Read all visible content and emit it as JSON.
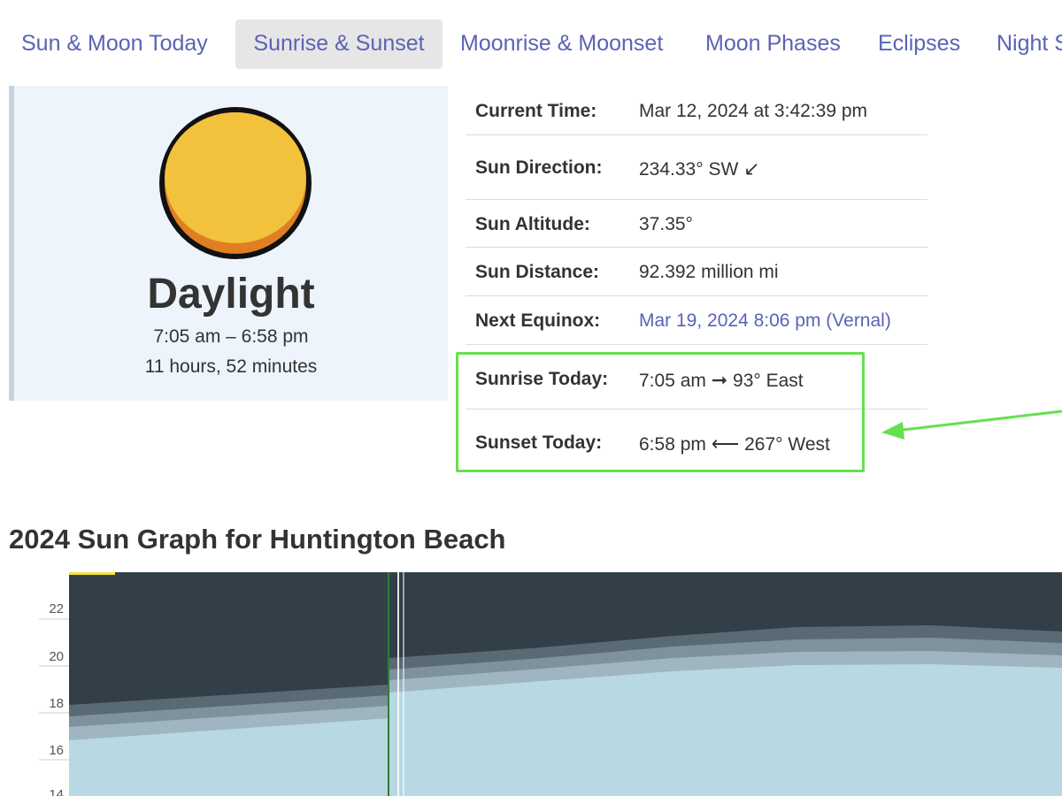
{
  "nav": {
    "tabs": [
      {
        "label": "Sun & Moon Today",
        "active": false
      },
      {
        "label": "Sunrise & Sunset",
        "active": true
      },
      {
        "label": "Moonrise & Moonset",
        "active": false
      },
      {
        "label": "Moon Phases",
        "active": false
      },
      {
        "label": "Eclipses",
        "active": false
      },
      {
        "label": "Night S",
        "active": false
      }
    ]
  },
  "sun_panel": {
    "icon": "sun-icon",
    "title": "Daylight",
    "range": "7:05 am – 6:58 pm",
    "length": "11 hours, 52 minutes",
    "colors": {
      "sun_fill": "#f2c23c",
      "sun_shade": "#e07f22",
      "outline": "#111111"
    }
  },
  "info": {
    "current_time": {
      "label": "Current Time:",
      "value": "Mar 12, 2024 at 3:42:39 pm"
    },
    "sun_direction": {
      "label": "Sun Direction:",
      "value": "234.33° SW",
      "arrow": "↙"
    },
    "sun_altitude": {
      "label": "Sun Altitude:",
      "value": "37.35°"
    },
    "sun_distance": {
      "label": "Sun Distance:",
      "value": "92.392 million mi"
    },
    "next_equinox": {
      "label": "Next Equinox:",
      "value": "Mar 19, 2024 8:06 pm (Vernal)"
    },
    "sunrise_today": {
      "label": "Sunrise Today:",
      "time": "7:05 am",
      "arrow": "➞",
      "direction": "93° East"
    },
    "sunset_today": {
      "label": "Sunset Today:",
      "time": "6:58 pm",
      "arrow": "⟵",
      "direction": "267° West"
    }
  },
  "highlight_color": "#66e04e",
  "graph": {
    "title": "2024 Sun Graph for Huntington Beach",
    "y_ticks": [
      "22",
      "20",
      "18",
      "16",
      "14"
    ],
    "colors": {
      "night": "#323f48",
      "twilight1": "#5a6a74",
      "twilight2": "#7d929d",
      "twilight3": "#9fb5c0",
      "day": "#b8d8e3",
      "marker": "#2e7d32"
    }
  }
}
